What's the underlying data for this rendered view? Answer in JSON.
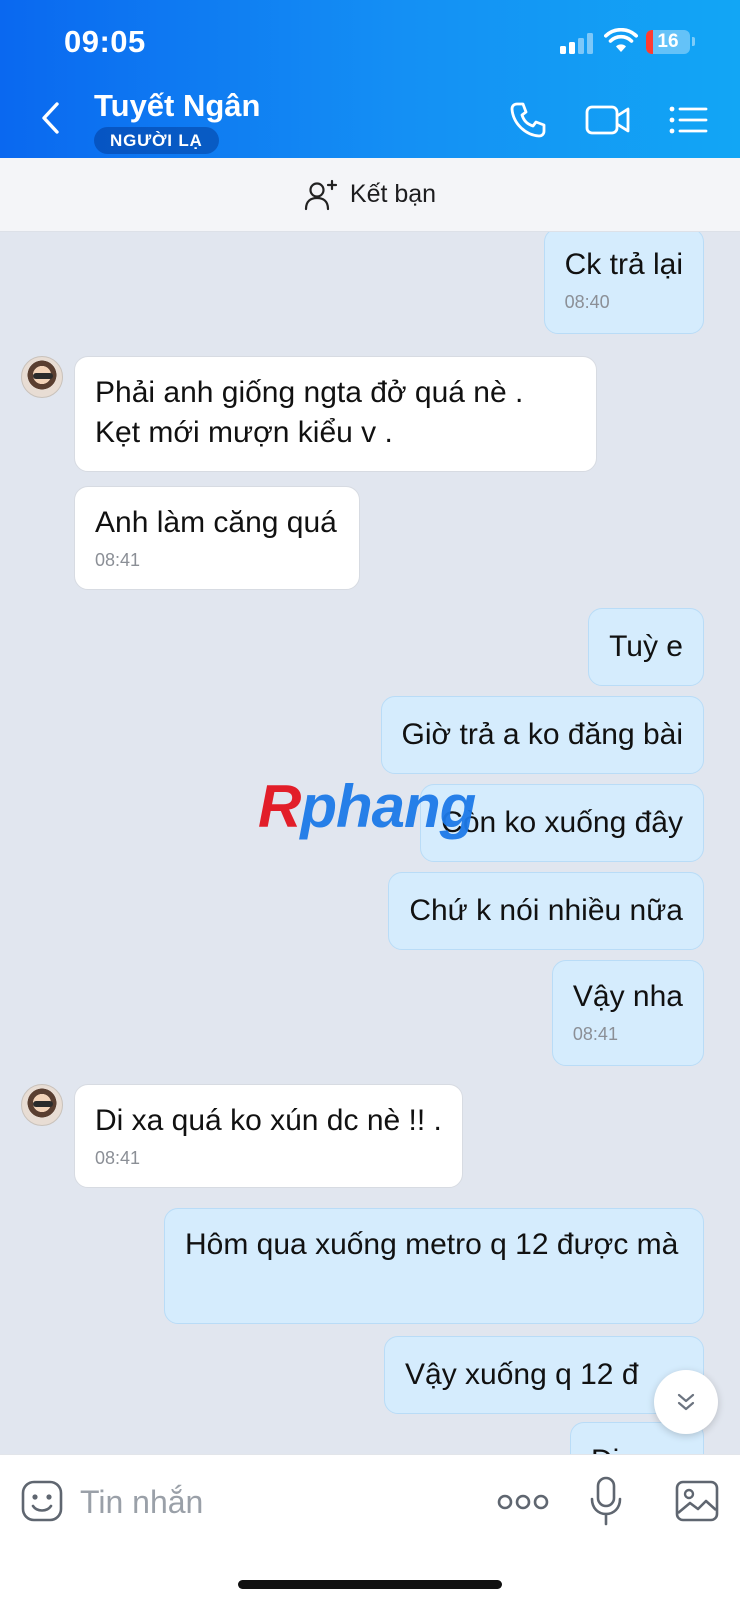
{
  "status_bar": {
    "time": "09:05",
    "battery": "16"
  },
  "header": {
    "contact_name": "Tuyết Ngân",
    "badge": "NGƯỜI LẠ"
  },
  "friend_bar": {
    "label": "Kết bạn"
  },
  "messages": [
    {
      "dir": "out",
      "text": "Ck trả lại",
      "time": "08:40"
    },
    {
      "dir": "in",
      "text": "Phải anh giống ngta đở quá nè . Kẹt mới mượn kiểu v ."
    },
    {
      "dir": "in",
      "text": "Anh làm căng quá",
      "time": "08:41"
    },
    {
      "dir": "out",
      "text": "Tuỳ e"
    },
    {
      "dir": "out",
      "text": "Giờ trả a ko đăng bài"
    },
    {
      "dir": "out",
      "text": "Còn ko xuống đây"
    },
    {
      "dir": "out",
      "text": "Chứ k nói nhiều nữa"
    },
    {
      "dir": "out",
      "text": "Vậy nha",
      "time": "08:41"
    },
    {
      "dir": "in",
      "text": "Di xa quá ko xún dc nè !! .",
      "time": "08:41"
    },
    {
      "dir": "out",
      "text": "Hôm qua xuống metro q 12 được mà"
    },
    {
      "dir": "out",
      "text": "Vậy xuống q 12 đ"
    },
    {
      "dir": "out",
      "text": "Đi"
    }
  ],
  "watermark": {
    "first": "R",
    "rest": "phang"
  },
  "composer": {
    "placeholder": "Tin nhắn"
  },
  "colors": {
    "header_start": "#0a68f0",
    "header_end": "#12a6f5",
    "outgoing_bubble": "#d5ecfd",
    "incoming_bubble": "#ffffff",
    "chat_bg": "#e1e6ef"
  }
}
